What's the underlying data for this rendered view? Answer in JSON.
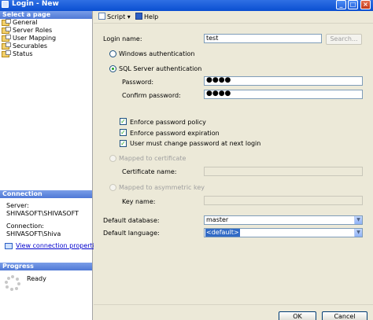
{
  "window": {
    "title": "Login - New"
  },
  "left": {
    "select_page_header": "Select a page",
    "pages": [
      {
        "label": "General",
        "icon": "page-icon"
      },
      {
        "label": "Server Roles",
        "icon": "page-icon"
      },
      {
        "label": "User Mapping",
        "icon": "page-icon"
      },
      {
        "label": "Securables",
        "icon": "page-icon"
      },
      {
        "label": "Status",
        "icon": "page-icon"
      }
    ],
    "connection_header": "Connection",
    "server_label": "Server:",
    "server_value": "SHIVASOFT\\SHIVASOFT",
    "connection_label": "Connection:",
    "connection_value": "SHIVASOFT\\Shiva",
    "view_connection_link": "View connection properties",
    "progress_header": "Progress",
    "progress_status": "Ready"
  },
  "toolbar": {
    "script_label": "Script",
    "help_label": "Help"
  },
  "form": {
    "login_name_label": "Login name:",
    "login_name_value": "test",
    "search_button": "Search...",
    "windows_auth_label": "Windows authentication",
    "sql_auth_label": "SQL Server authentication",
    "password_label": "Password:",
    "password_value": "●●●●",
    "confirm_password_label": "Confirm password:",
    "confirm_password_value": "●●●●",
    "enforce_policy_label": "Enforce password policy",
    "enforce_expiration_label": "Enforce password expiration",
    "must_change_label": "User must change password at next login",
    "mapped_cert_label": "Mapped to certificate",
    "cert_name_label": "Certificate name:",
    "mapped_key_label": "Mapped to asymmetric key",
    "key_name_label": "Key name:",
    "default_db_label": "Default database:",
    "default_db_value": "master",
    "default_lang_label": "Default language:",
    "default_lang_value": "<default>"
  },
  "footer": {
    "ok_label": "OK",
    "cancel_label": "Cancel"
  }
}
